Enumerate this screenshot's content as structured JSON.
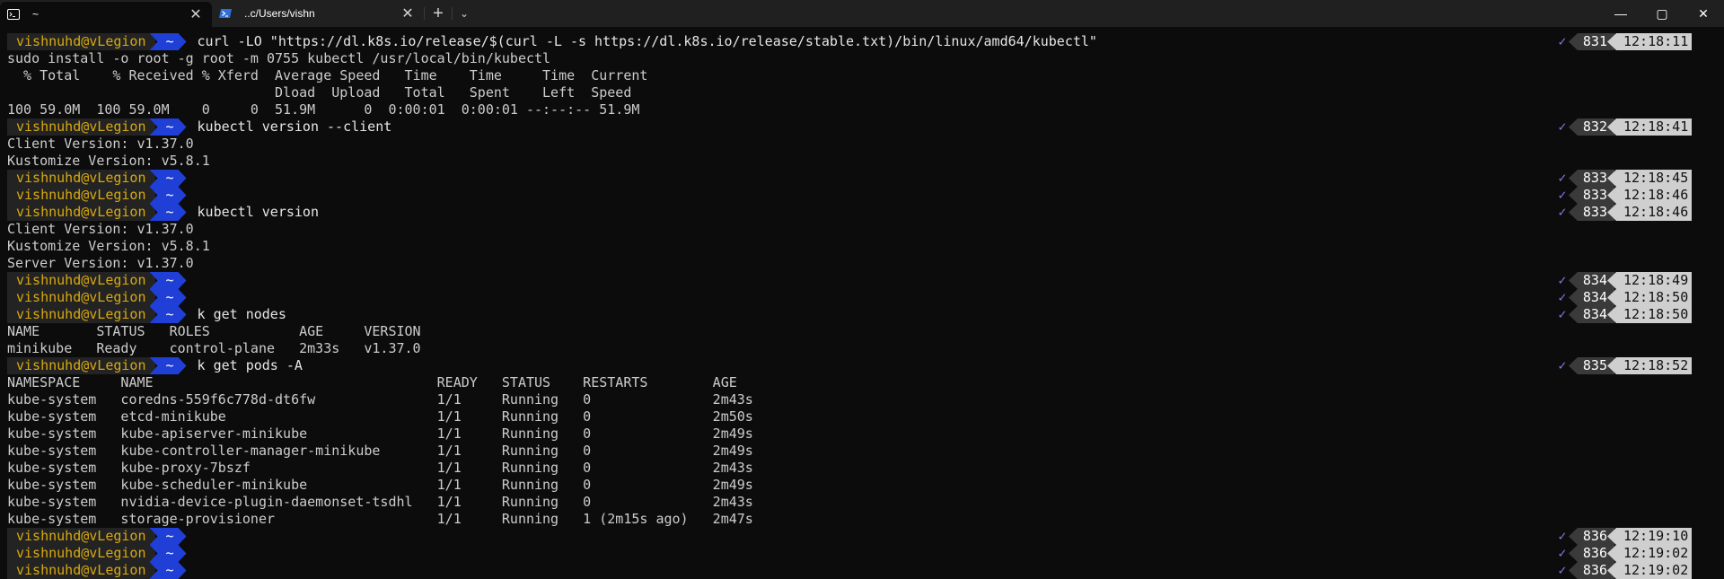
{
  "tabs": [
    {
      "title": "~",
      "icon": "terminal-icon"
    },
    {
      "title": "..c/Users/vishn",
      "icon": "powershell-icon"
    }
  ],
  "window_controls": {
    "minimize": "—",
    "maximize": "▢",
    "close": "✕"
  },
  "prompt": {
    "user": "vishnuhd@vLegion",
    "dir": "~"
  },
  "lines": [
    {
      "type": "prompt",
      "cmd": "curl -LO \"https://dl.k8s.io/release/$(curl -L -s https://dl.k8s.io/release/stable.txt)/bin/linux/amd64/kubectl\"",
      "num": "831",
      "time": "12:18:11"
    },
    {
      "type": "out",
      "text": "sudo install -o root -g root -m 0755 kubectl /usr/local/bin/kubectl"
    },
    {
      "type": "out",
      "text": "  % Total    % Received % Xferd  Average Speed   Time    Time     Time  Current"
    },
    {
      "type": "out",
      "text": "                                 Dload  Upload   Total   Spent    Left  Speed"
    },
    {
      "type": "out",
      "text": "100 59.0M  100 59.0M    0     0  51.9M      0  0:00:01  0:00:01 --:--:-- 51.9M"
    },
    {
      "type": "prompt",
      "cmd": "kubectl version --client",
      "num": "832",
      "time": "12:18:41"
    },
    {
      "type": "out",
      "text": "Client Version: v1.37.0"
    },
    {
      "type": "out",
      "text": "Kustomize Version: v5.8.1"
    },
    {
      "type": "prompt",
      "cmd": "",
      "num": "833",
      "time": "12:18:45"
    },
    {
      "type": "prompt",
      "cmd": "",
      "num": "833",
      "time": "12:18:46"
    },
    {
      "type": "prompt",
      "cmd": "kubectl version",
      "num": "833",
      "time": "12:18:46"
    },
    {
      "type": "out",
      "text": "Client Version: v1.37.0"
    },
    {
      "type": "out",
      "text": "Kustomize Version: v5.8.1"
    },
    {
      "type": "out",
      "text": "Server Version: v1.37.0"
    },
    {
      "type": "prompt",
      "cmd": "",
      "num": "834",
      "time": "12:18:49"
    },
    {
      "type": "prompt",
      "cmd": "",
      "num": "834",
      "time": "12:18:50"
    },
    {
      "type": "prompt",
      "cmd": "k get nodes",
      "num": "834",
      "time": "12:18:50"
    },
    {
      "type": "out",
      "text": "NAME       STATUS   ROLES           AGE     VERSION"
    },
    {
      "type": "out",
      "text": "minikube   Ready    control-plane   2m33s   v1.37.0"
    },
    {
      "type": "prompt",
      "cmd": "k get pods -A",
      "num": "835",
      "time": "12:18:52"
    },
    {
      "type": "out",
      "text": "NAMESPACE     NAME                                   READY   STATUS    RESTARTS        AGE"
    },
    {
      "type": "out",
      "text": "kube-system   coredns-559f6c778d-dt6fw               1/1     Running   0               2m43s"
    },
    {
      "type": "out",
      "text": "kube-system   etcd-minikube                          1/1     Running   0               2m50s"
    },
    {
      "type": "out",
      "text": "kube-system   kube-apiserver-minikube                1/1     Running   0               2m49s"
    },
    {
      "type": "out",
      "text": "kube-system   kube-controller-manager-minikube       1/1     Running   0               2m49s"
    },
    {
      "type": "out",
      "text": "kube-system   kube-proxy-7bszf                       1/1     Running   0               2m43s"
    },
    {
      "type": "out",
      "text": "kube-system   kube-scheduler-minikube                1/1     Running   0               2m49s"
    },
    {
      "type": "out",
      "text": "kube-system   nvidia-device-plugin-daemonset-tsdhl   1/1     Running   0               2m43s"
    },
    {
      "type": "out",
      "text": "kube-system   storage-provisioner                    1/1     Running   1 (2m15s ago)   2m47s"
    },
    {
      "type": "prompt",
      "cmd": "",
      "num": "836",
      "time": "12:19:10"
    },
    {
      "type": "prompt",
      "cmd": "",
      "num": "836",
      "time": "12:19:02"
    },
    {
      "type": "prompt",
      "cmd": "",
      "num": "836",
      "time": "12:19:02"
    }
  ]
}
